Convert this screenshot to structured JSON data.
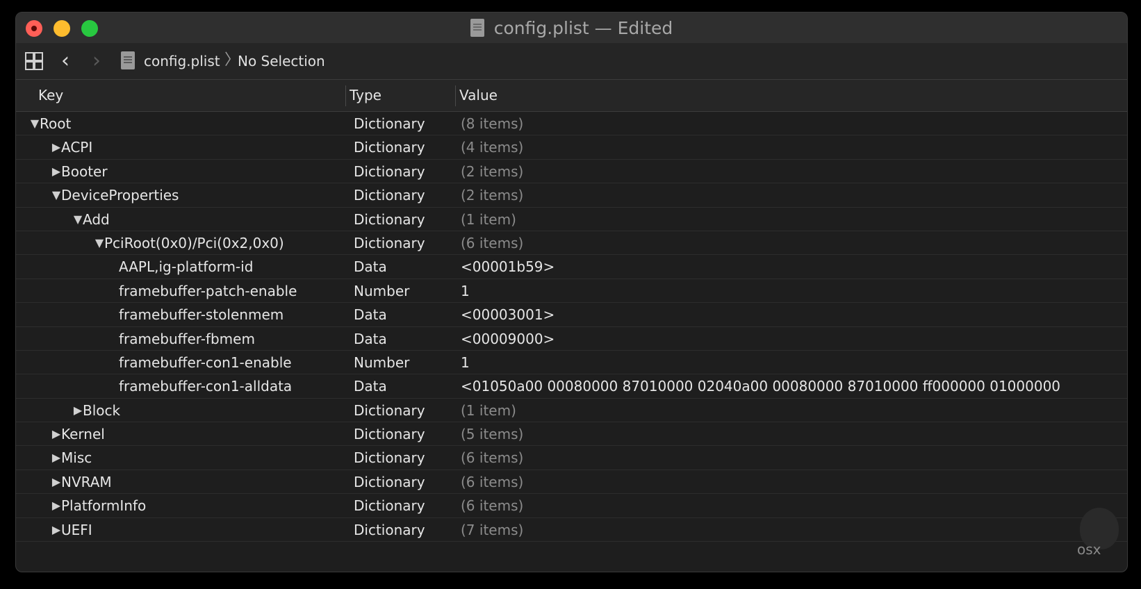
{
  "window": {
    "title": "config.plist — Edited",
    "colors": {
      "close": "#ff5f57",
      "minimize": "#febc2e",
      "zoom": "#28c840"
    }
  },
  "toolbar": {
    "breadcrumb_file": "config.plist",
    "breadcrumb_separator": "〉",
    "breadcrumb_selection": "No Selection",
    "icons": [
      "grid-icon",
      "back-chevron-icon",
      "forward-chevron-icon",
      "document-icon"
    ]
  },
  "columns": {
    "key": "Key",
    "type": "Type",
    "value": "Value"
  },
  "rows": [
    {
      "key": "Root",
      "type": "Dictionary",
      "value": "(8 items)",
      "depth": 0,
      "disclosure": "expanded",
      "muted": true
    },
    {
      "key": "ACPI",
      "type": "Dictionary",
      "value": "(4 items)",
      "depth": 1,
      "disclosure": "collapsed",
      "muted": true
    },
    {
      "key": "Booter",
      "type": "Dictionary",
      "value": "(2 items)",
      "depth": 1,
      "disclosure": "collapsed",
      "muted": true
    },
    {
      "key": "DeviceProperties",
      "type": "Dictionary",
      "value": "(2 items)",
      "depth": 1,
      "disclosure": "expanded",
      "muted": true
    },
    {
      "key": "Add",
      "type": "Dictionary",
      "value": "(1 item)",
      "depth": 2,
      "disclosure": "expanded",
      "muted": true
    },
    {
      "key": "PciRoot(0x0)/Pci(0x2,0x0)",
      "type": "Dictionary",
      "value": "(6 items)",
      "depth": 3,
      "disclosure": "expanded",
      "muted": true
    },
    {
      "key": "AAPL,ig-platform-id",
      "type": "Data",
      "value": "<00001b59>",
      "depth": 4,
      "disclosure": "none",
      "muted": false
    },
    {
      "key": "framebuffer-patch-enable",
      "type": "Number",
      "value": "1",
      "depth": 4,
      "disclosure": "none",
      "muted": false
    },
    {
      "key": "framebuffer-stolenmem",
      "type": "Data",
      "value": "<00003001>",
      "depth": 4,
      "disclosure": "none",
      "muted": false
    },
    {
      "key": "framebuffer-fbmem",
      "type": "Data",
      "value": "<00009000>",
      "depth": 4,
      "disclosure": "none",
      "muted": false
    },
    {
      "key": "framebuffer-con1-enable",
      "type": "Number",
      "value": "1",
      "depth": 4,
      "disclosure": "none",
      "muted": false
    },
    {
      "key": "framebuffer-con1-alldata",
      "type": "Data",
      "value": "<01050a00 00080000 87010000 02040a00 00080000 87010000 ff000000 01000000",
      "depth": 4,
      "disclosure": "none",
      "muted": false
    },
    {
      "key": "Block",
      "type": "Dictionary",
      "value": "(1 item)",
      "depth": 2,
      "disclosure": "collapsed",
      "muted": true
    },
    {
      "key": "Kernel",
      "type": "Dictionary",
      "value": "(5 items)",
      "depth": 1,
      "disclosure": "collapsed",
      "muted": true
    },
    {
      "key": "Misc",
      "type": "Dictionary",
      "value": "(6 items)",
      "depth": 1,
      "disclosure": "collapsed",
      "muted": true
    },
    {
      "key": "NVRAM",
      "type": "Dictionary",
      "value": "(6 items)",
      "depth": 1,
      "disclosure": "collapsed",
      "muted": true
    },
    {
      "key": "PlatformInfo",
      "type": "Dictionary",
      "value": "(6 items)",
      "depth": 1,
      "disclosure": "collapsed",
      "muted": true
    },
    {
      "key": "UEFI",
      "type": "Dictionary",
      "value": "(7 items)",
      "depth": 1,
      "disclosure": "collapsed",
      "muted": true
    }
  ],
  "watermark": {
    "text": "osx"
  }
}
